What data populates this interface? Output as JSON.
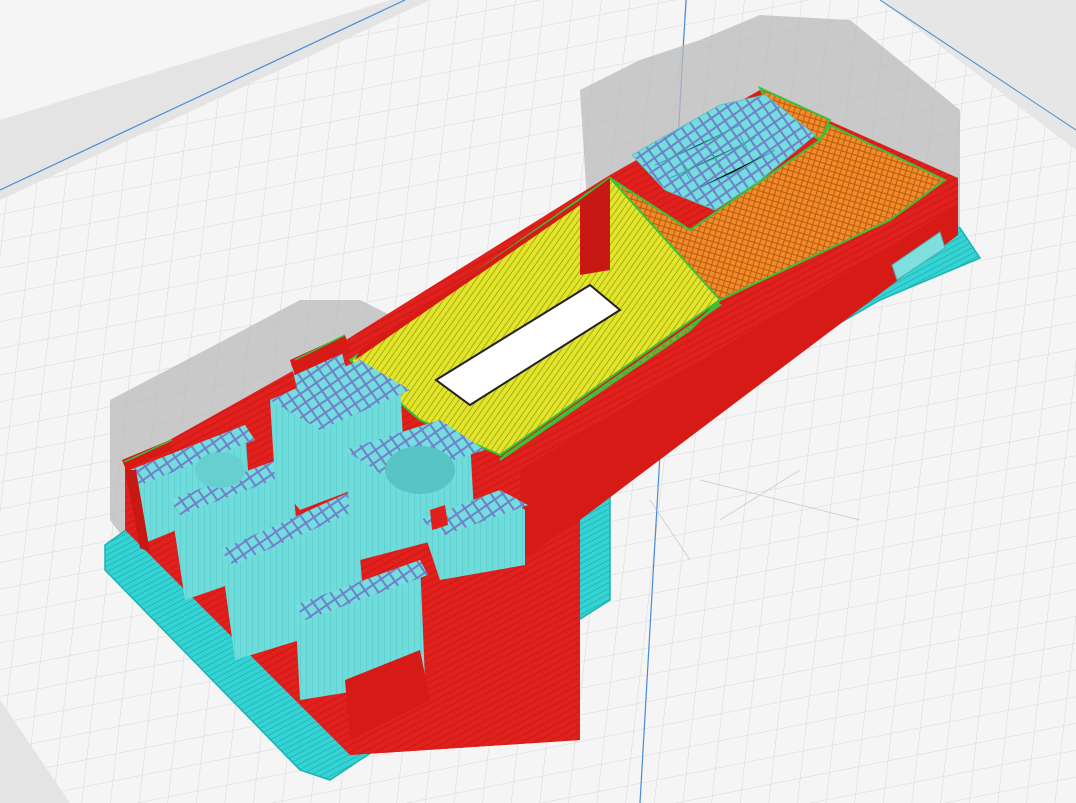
{
  "app": {
    "view": "layer-preview",
    "description_colors": {
      "background": "#f2f2f2",
      "grid_line": "#d6d6d6",
      "axis_blue": "#4a8bd8",
      "bed_edge": "#e9e9e9",
      "wall_outer": "#e0201c",
      "wall_inner": "#c81814",
      "infill_orange": "#f28c28",
      "skin_yellow": "#e3e52a",
      "support_cyan": "#6fdcdc",
      "brim_cyan": "#2ed6d6",
      "outline_green": "#36c23a",
      "shadow_grey": "#b8b8b8"
    }
  },
  "scene": {
    "objects": [
      {
        "name": "model-body",
        "material": "wall"
      },
      {
        "name": "top-infill",
        "material": "infill"
      },
      {
        "name": "inner-pocket",
        "material": "skin"
      },
      {
        "name": "supports-left",
        "material": "support"
      },
      {
        "name": "supports-top",
        "material": "support"
      },
      {
        "name": "brim",
        "material": "brim"
      }
    ]
  }
}
